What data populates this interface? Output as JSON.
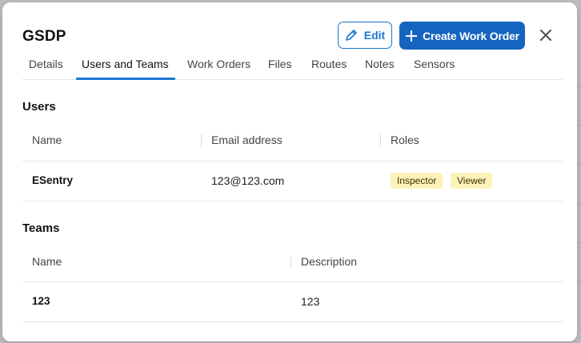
{
  "modal": {
    "title": "GSDP",
    "edit_label": "Edit",
    "create_label": "Create Work Order"
  },
  "tabs": [
    {
      "label": "Details"
    },
    {
      "label": "Users and Teams"
    },
    {
      "label": "Work Orders"
    },
    {
      "label": "Files"
    },
    {
      "label": "Routes"
    },
    {
      "label": "Notes"
    },
    {
      "label": "Sensors"
    }
  ],
  "active_tab": "Users and Teams",
  "users": {
    "title": "Users",
    "columns": [
      "Name",
      "Email address",
      "Roles"
    ],
    "rows": [
      {
        "name": "ESentry",
        "email": "123@123.com",
        "roles": [
          "Inspector",
          "Viewer"
        ]
      }
    ]
  },
  "teams": {
    "title": "Teams",
    "columns": [
      "Name",
      "Description"
    ],
    "rows": [
      {
        "name": "123",
        "description": "123"
      }
    ]
  },
  "colors": {
    "accent": "#1976d2",
    "primary_button": "#1565c0",
    "badge_bg": "#fdf3b8"
  }
}
